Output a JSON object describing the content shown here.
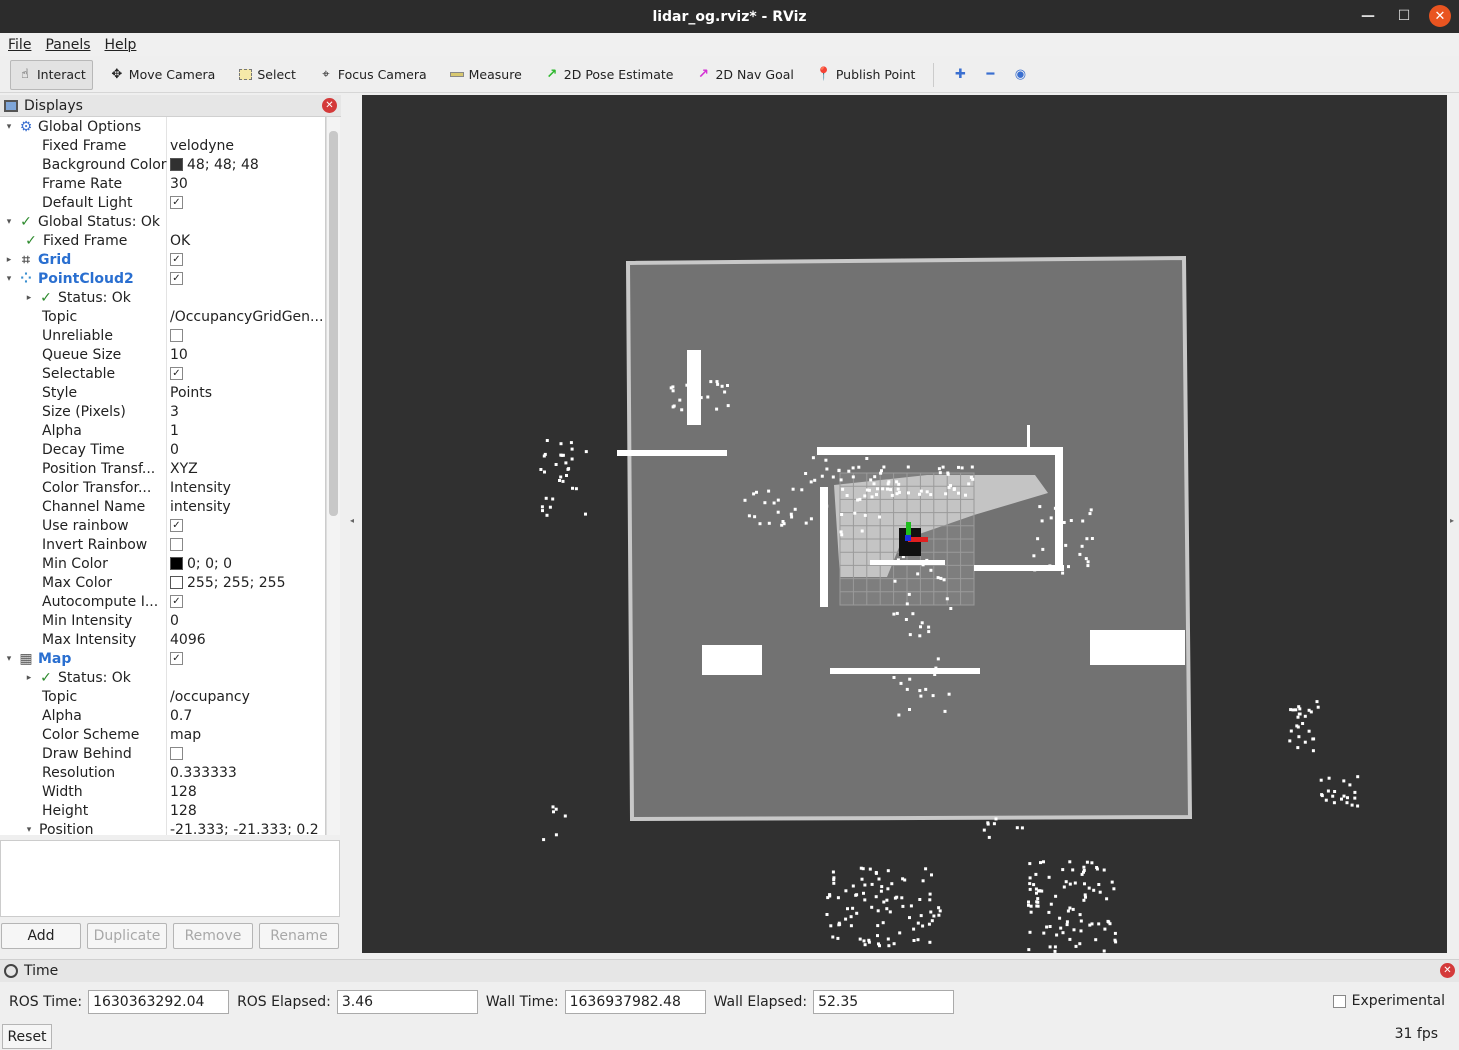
{
  "window": {
    "title": "lidar_og.rviz* - RViz"
  },
  "menu": [
    "File",
    "Panels",
    "Help"
  ],
  "toolbar": {
    "tools": [
      {
        "label": "Interact",
        "icon": "cursor-icon",
        "active": true
      },
      {
        "label": "Move Camera",
        "icon": "move-camera-icon"
      },
      {
        "label": "Select",
        "icon": "select-icon"
      },
      {
        "label": "Focus Camera",
        "icon": "focus-camera-icon"
      },
      {
        "label": "Measure",
        "icon": "ruler-icon"
      },
      {
        "label": "2D Pose Estimate",
        "icon": "green-arrow-icon"
      },
      {
        "label": "2D Nav Goal",
        "icon": "pink-arrow-icon"
      },
      {
        "label": "Publish Point",
        "icon": "map-pin-icon"
      }
    ]
  },
  "displays": {
    "title": "Displays",
    "rows": [
      {
        "indent": 0,
        "arrow": "▾",
        "icon": "gear",
        "name": "Global Options",
        "value": ""
      },
      {
        "indent": 1,
        "name": "Fixed Frame",
        "value": "velodyne"
      },
      {
        "indent": 1,
        "name": "Background Color",
        "value": "48; 48; 48",
        "swatch": "#303030"
      },
      {
        "indent": 1,
        "name": "Frame Rate",
        "value": "30"
      },
      {
        "indent": 1,
        "name": "Default Light",
        "cb": true
      },
      {
        "indent": 0,
        "arrow": "▾",
        "icon": "check",
        "name": "Global Status: Ok",
        "value": ""
      },
      {
        "indent": 1,
        "icon": "check",
        "name": "Fixed Frame",
        "value": "OK"
      },
      {
        "indent": 0,
        "arrow": "▸",
        "icon": "grid",
        "name": "Grid",
        "blue": true,
        "cb": true
      },
      {
        "indent": 0,
        "arrow": "▾",
        "icon": "cloud",
        "name": "PointCloud2",
        "blue": true,
        "cb": true
      },
      {
        "indent": 1,
        "arrow": "▸",
        "icon": "check",
        "name": "Status: Ok",
        "value": ""
      },
      {
        "indent": 1,
        "name": "Topic",
        "value": "/OccupancyGridGen..."
      },
      {
        "indent": 1,
        "name": "Unreliable",
        "cb": false
      },
      {
        "indent": 1,
        "name": "Queue Size",
        "value": "10"
      },
      {
        "indent": 1,
        "name": "Selectable",
        "cb": true
      },
      {
        "indent": 1,
        "name": "Style",
        "value": "Points"
      },
      {
        "indent": 1,
        "name": "Size (Pixels)",
        "value": "3"
      },
      {
        "indent": 1,
        "name": "Alpha",
        "value": "1"
      },
      {
        "indent": 1,
        "name": "Decay Time",
        "value": "0"
      },
      {
        "indent": 1,
        "name": "Position Transf...",
        "value": "XYZ"
      },
      {
        "indent": 1,
        "name": "Color Transfor...",
        "value": "Intensity"
      },
      {
        "indent": 1,
        "name": "Channel Name",
        "value": "intensity"
      },
      {
        "indent": 1,
        "name": "Use rainbow",
        "cb": true
      },
      {
        "indent": 1,
        "name": "Invert Rainbow",
        "cb": false
      },
      {
        "indent": 1,
        "name": "Min Color",
        "value": "0; 0; 0",
        "swatch": "#000000"
      },
      {
        "indent": 1,
        "name": "Max Color",
        "value": "255; 255; 255",
        "swatch": "#ffffff"
      },
      {
        "indent": 1,
        "name": "Autocompute I...",
        "cb": true
      },
      {
        "indent": 1,
        "name": "Min Intensity",
        "value": "0"
      },
      {
        "indent": 1,
        "name": "Max Intensity",
        "value": "4096"
      },
      {
        "indent": 0,
        "arrow": "▾",
        "icon": "map",
        "name": "Map",
        "blue": true,
        "cb": true
      },
      {
        "indent": 1,
        "arrow": "▸",
        "icon": "check",
        "name": "Status: Ok",
        "value": ""
      },
      {
        "indent": 1,
        "name": "Topic",
        "value": "/occupancy"
      },
      {
        "indent": 1,
        "name": "Alpha",
        "value": "0.7"
      },
      {
        "indent": 1,
        "name": "Color Scheme",
        "value": "map"
      },
      {
        "indent": 1,
        "name": "Draw Behind",
        "cb": false
      },
      {
        "indent": 1,
        "name": "Resolution",
        "value": "0.333333"
      },
      {
        "indent": 1,
        "name": "Width",
        "value": "128"
      },
      {
        "indent": 1,
        "name": "Height",
        "value": "128"
      },
      {
        "indent": 1,
        "arrow": "▾",
        "name": "Position",
        "value": "-21.333; -21.333; 0.2"
      }
    ],
    "buttons": {
      "add": "Add",
      "duplicate": "Duplicate",
      "remove": "Remove",
      "rename": "Rename"
    }
  },
  "time": {
    "title": "Time",
    "ros_time_label": "ROS Time:",
    "ros_time": "1630363292.04",
    "ros_elapsed_label": "ROS Elapsed:",
    "ros_elapsed": "3.46",
    "wall_time_label": "Wall Time:",
    "wall_time": "1636937982.48",
    "wall_elapsed_label": "Wall Elapsed:",
    "wall_elapsed": "52.35",
    "experimental_label": "Experimental",
    "reset_label": "Reset",
    "fps": "31 fps"
  }
}
